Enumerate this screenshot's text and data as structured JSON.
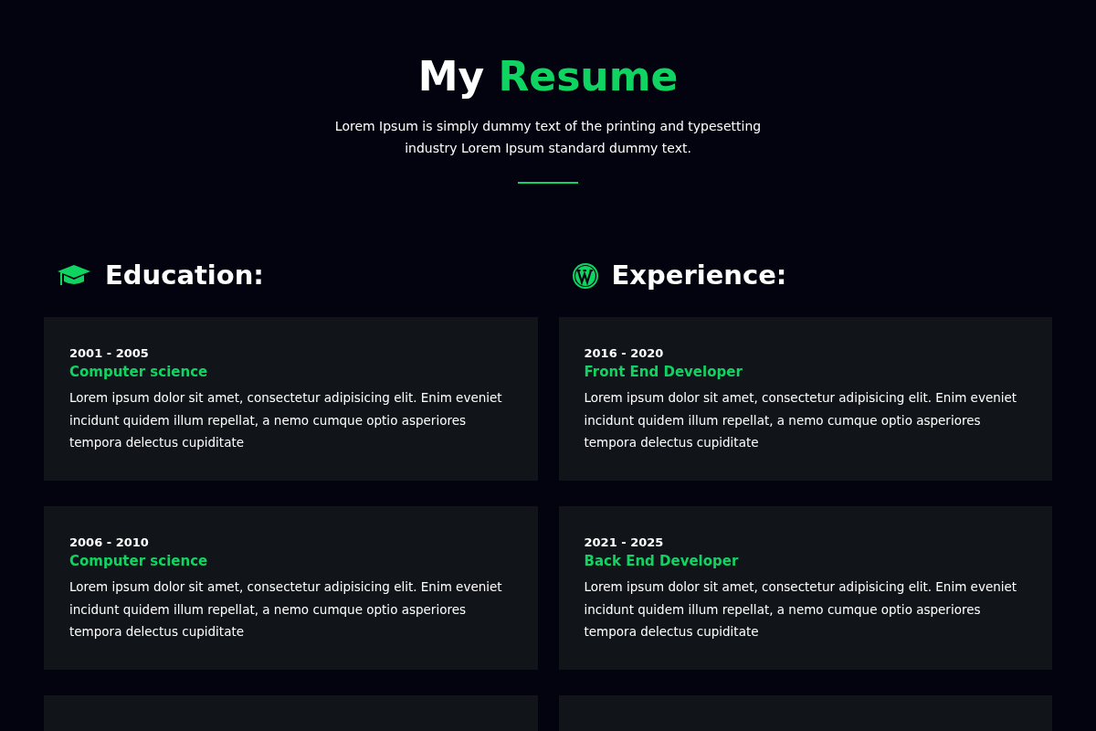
{
  "header": {
    "title_plain": "My",
    "title_accent": "Resume",
    "subtitle": "Lorem Ipsum is simply dummy text of the printing and typesetting industry Lorem Ipsum standard dummy text."
  },
  "columns": [
    {
      "kind": "education",
      "heading": "Education:",
      "entries": [
        {
          "years": "2001 - 2005",
          "title": "Computer science",
          "text": "Lorem ipsum dolor sit amet, consectetur adipisicing elit. Enim eveniet incidunt quidem illum repellat, a nemo cumque optio asperiores tempora delectus cupiditate"
        },
        {
          "years": "2006 - 2010",
          "title": "Computer science",
          "text": "Lorem ipsum dolor sit amet, consectetur adipisicing elit. Enim eveniet incidunt quidem illum repellat, a nemo cumque optio asperiores tempora delectus cupiditate"
        }
      ]
    },
    {
      "kind": "experience",
      "heading": "Experience:",
      "entries": [
        {
          "years": "2016 - 2020",
          "title": "Front End Developer",
          "text": "Lorem ipsum dolor sit amet, consectetur adipisicing elit. Enim eveniet incidunt quidem illum repellat, a nemo cumque optio asperiores tempora delectus cupiditate"
        },
        {
          "years": "2021 - 2025",
          "title": "Back End Developer",
          "text": "Lorem ipsum dolor sit amet, consectetur adipisicing elit. Enim eveniet incidunt quidem illum repellat, a nemo cumque optio asperiores tempora delectus cupiditate"
        }
      ]
    }
  ]
}
